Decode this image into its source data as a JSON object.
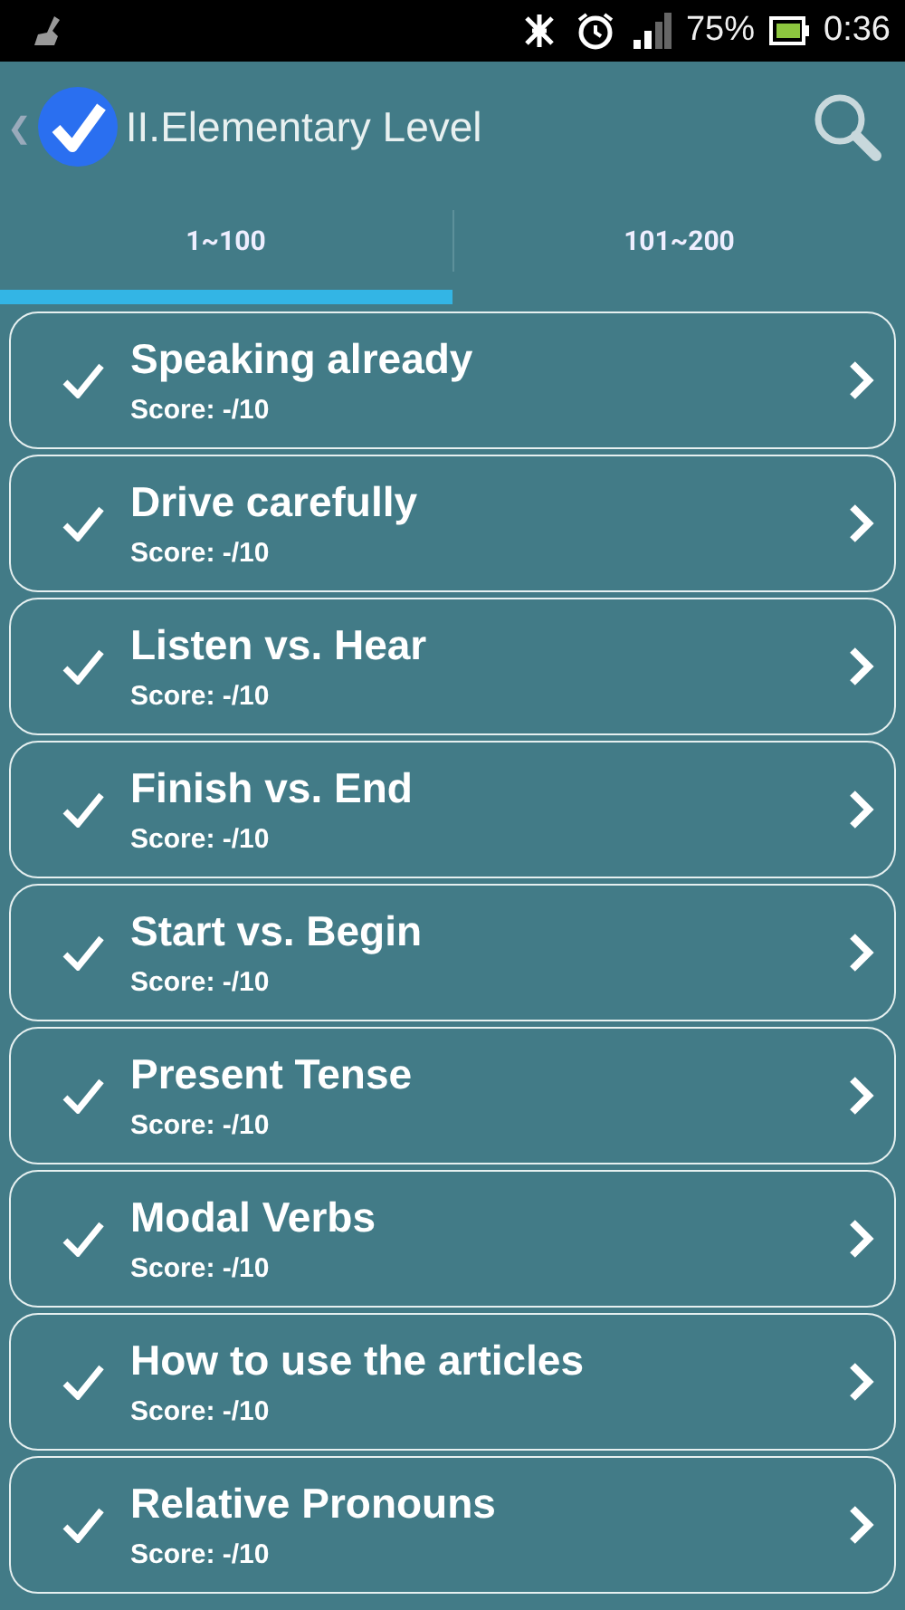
{
  "status_bar": {
    "battery_percent": "75%",
    "time": "0:36"
  },
  "app_bar": {
    "back": "❮",
    "title": "II.Elementary Level"
  },
  "tabs": [
    {
      "label": "1~100",
      "selected": true
    },
    {
      "label": "101~200",
      "selected": false
    }
  ],
  "lessons": [
    {
      "title": "Speaking already",
      "score": "Score: -/10"
    },
    {
      "title": "Drive carefully",
      "score": "Score: -/10"
    },
    {
      "title": "Listen vs. Hear",
      "score": "Score: -/10"
    },
    {
      "title": "Finish vs. End",
      "score": "Score: -/10"
    },
    {
      "title": "Start vs. Begin",
      "score": "Score: -/10"
    },
    {
      "title": "Present Tense",
      "score": "Score: -/10"
    },
    {
      "title": "Modal Verbs",
      "score": "Score: -/10"
    },
    {
      "title": "How to use the articles",
      "score": "Score: -/10"
    },
    {
      "title": "Relative Pronouns",
      "score": "Score: -/10"
    }
  ]
}
